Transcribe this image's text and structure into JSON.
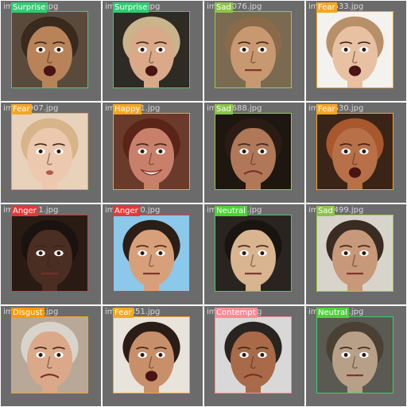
{
  "tiles": [
    {
      "label": "Surprise",
      "filename": "im028908.jpg",
      "box": "#37d26a",
      "skin": "#b9835a",
      "hair": "#3a2a1e",
      "bg": "#5a4a3c",
      "mouth": "open"
    },
    {
      "label": "Surprise",
      "filename": "im028878.jpg",
      "box": "#37d26a",
      "skin": "#d9a98a",
      "hair": "#c9b48c",
      "bg": "#2e2a24",
      "mouth": "open"
    },
    {
      "label": "Sad",
      "filename": "im029076.jpg",
      "box": "#9acd32",
      "skin": "#c89870",
      "hair": "#8a6a48",
      "bg": "#7a6a52",
      "mouth": "flat"
    },
    {
      "label": "Fear",
      "filename": "im028533.jpg",
      "box": "#f5a623",
      "skin": "#e8c0a2",
      "hair": "#b89068",
      "bg": "#f4f2ee",
      "mouth": "open"
    },
    {
      "label": "Fear",
      "filename": "im028907.jpg",
      "box": "#f5a623",
      "skin": "#ecc8ae",
      "hair": "#d8b48a",
      "bg": "#e8d2bc",
      "mouth": "small"
    },
    {
      "label": "Happy",
      "filename": "im028871.jpg",
      "box": "#f5a623",
      "skin": "#c8806a",
      "hair": "#5a2418",
      "bg": "#6a3a2a",
      "mouth": "smile"
    },
    {
      "label": "Sad",
      "filename": "im028688.jpg",
      "box": "#9acd32",
      "skin": "#b07858",
      "hair": "#2a1c14",
      "bg": "#1e1610",
      "mouth": "frown"
    },
    {
      "label": "Fear",
      "filename": "im028530.jpg",
      "box": "#f5a623",
      "skin": "#b87048",
      "hair": "#a8582c",
      "bg": "#3a2418",
      "mouth": "open"
    },
    {
      "label": "Anger",
      "filename": "im028901.jpg",
      "box": "#e53935",
      "skin": "#4a2e22",
      "hair": "#1a1210",
      "bg": "#2a1a14",
      "mouth": "flat"
    },
    {
      "label": "Anger",
      "filename": "im028870.jpg",
      "box": "#e53935",
      "skin": "#d8a07a",
      "hair": "#2a1e16",
      "bg": "#8cc8ea",
      "mouth": "flat"
    },
    {
      "label": "Neutral",
      "filename": "im028646.jpg",
      "box": "#37d26a",
      "skin": "#d8b490",
      "hair": "#1a1410",
      "bg": "#2a2420",
      "mouth": "flat"
    },
    {
      "label": "Sad",
      "filename": "im028499.jpg",
      "box": "#9acd32",
      "skin": "#c8987a",
      "hair": "#3a2c22",
      "bg": "#d8d4cc",
      "mouth": "flat"
    },
    {
      "label": "Disgust",
      "filename": "im028896.jpg",
      "box": "#f5a623",
      "skin": "#dca88a",
      "hair": "#d8d4cc",
      "bg": "#b8a898",
      "mouth": "frown"
    },
    {
      "label": "Fear",
      "filename": "im028851.jpg",
      "box": "#f5a623",
      "skin": "#c8906a",
      "hair": "#2a1c16",
      "bg": "#e8e4dc",
      "mouth": "open"
    },
    {
      "label": "Contempt",
      "filename": "im028639.jpg",
      "box": "#ff8a95",
      "skin": "#a86a48",
      "hair": "#2a2420",
      "bg": "#d8d8d8",
      "mouth": "frown"
    },
    {
      "label": "Neutral",
      "filename": "im028484.jpg",
      "box": "#37d26a",
      "skin": "#b8a088",
      "hair": "#4a4034",
      "bg": "#5a5a52",
      "mouth": "flat"
    }
  ],
  "badge_colors": {
    "Surprise": "#2ecc71",
    "Sad": "#8bc34a",
    "Fear": "#f5a623",
    "Happy": "#f5a623",
    "Anger": "#e53935",
    "Neutral": "#4cd137",
    "Disgust": "#ff9800",
    "Contempt": "#ff8a95"
  }
}
